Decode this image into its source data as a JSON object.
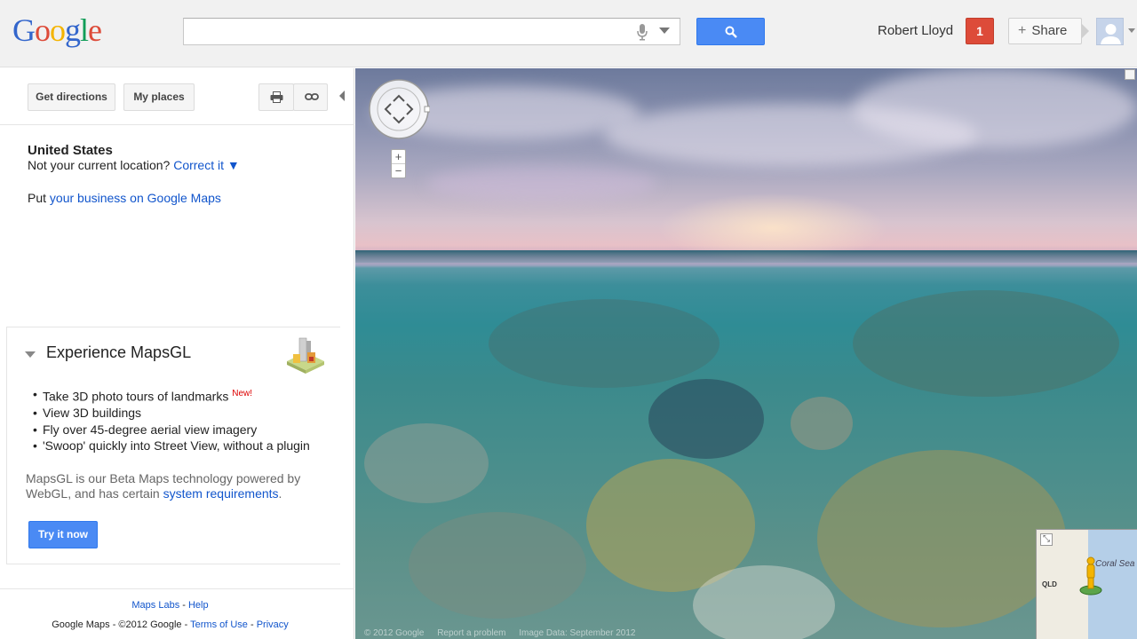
{
  "header": {
    "logo_letters": [
      "G",
      "o",
      "o",
      "g",
      "l",
      "e"
    ],
    "logo_colors": [
      "#3366cc",
      "#dd4b39",
      "#f4b400",
      "#3366cc",
      "#109d58",
      "#dd4b39"
    ],
    "search_value": "",
    "user_name": "Robert Lloyd",
    "notification_count": "1",
    "share_label": "Share"
  },
  "left_panel": {
    "toolbar": {
      "directions_label": "Get directions",
      "places_label": "My places"
    },
    "location": {
      "country": "United States",
      "prompt": "Not your current location?",
      "correct_link": "Correct it ▼"
    },
    "business": {
      "prefix": "Put",
      "link": "your business on Google Maps"
    },
    "mapsgl": {
      "title": "Experience MapsGL",
      "features": [
        "Take 3D photo tours of landmarks",
        "View 3D buildings",
        "Fly over 45-degree aerial view imagery",
        "'Swoop' quickly into Street View, without a plugin"
      ],
      "new_tag": "New!",
      "desc_text": "MapsGL is our Beta Maps technology powered by WebGL, and has certain",
      "desc_link": "system requirements",
      "desc_end": ".",
      "try_label": "Try it now"
    },
    "footer": {
      "labs": "Maps Labs",
      "sep1": " - ",
      "help": "Help",
      "copyright": "Google Maps - ©2012 Google - ",
      "terms": "Terms of Use",
      "sep2": " - ",
      "privacy": "Privacy"
    }
  },
  "map": {
    "footer": {
      "copyright": "© 2012 Google",
      "report": "Report a problem",
      "image_data": "Image Data: September 2012"
    },
    "minimap": {
      "label_region": "QLD",
      "label_sea": "Coral Sea"
    }
  },
  "colors": {
    "accent_blue": "#4a8af4",
    "link_blue": "#1155cc",
    "badge_red": "#dd4b39"
  }
}
